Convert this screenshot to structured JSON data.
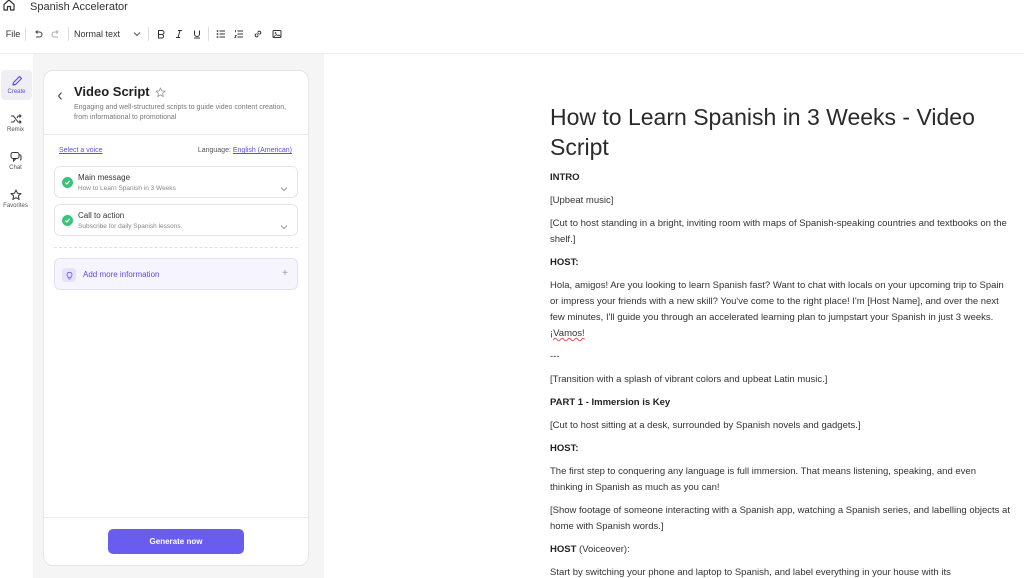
{
  "app": {
    "doc_title": "Spanish Accelerator"
  },
  "toolbar": {
    "file_label": "File",
    "text_style": "Normal text"
  },
  "rail": {
    "items": [
      {
        "label": "Create"
      },
      {
        "label": "Remix"
      },
      {
        "label": "Chat"
      },
      {
        "label": "Favorites"
      }
    ]
  },
  "panel": {
    "title": "Video Script",
    "description": "Engaging and well-structured scripts to guide video content creation, from informational to promotional",
    "voice_link": "Select a voice",
    "language_label": "Language:",
    "language_value": "English (American)",
    "fields": [
      {
        "title": "Main message",
        "value": "How to Learn Spanish in 3 Weeks"
      },
      {
        "title": "Call to action",
        "value": "Subscribe for daily Spanish lessons."
      }
    ],
    "add_info_label": "Add more information",
    "add_info_plus": "+",
    "generate_label": "Generate now"
  },
  "document": {
    "title": "How to Learn Spanish in 3 Weeks - Video Script",
    "intro": "INTRO",
    "p1": "[Upbeat music]",
    "p2": "[Cut to host standing in a bright, inviting room with maps of Spanish-speaking countries and textbooks on the shelf.]",
    "host1": "HOST:",
    "p3_main": "Hola, amigos! Are you looking to learn Spanish fast? Want to chat with locals on your upcoming trip to Spain or impress your friends with a new skill? You've come to the right place! I'm [Host Name], and over the next few minutes, I'll guide you through an accelerated learning plan to jumpstart your Spanish in just 3 weeks. ",
    "p3_spell": "¡Vamos!",
    "sep": "---",
    "p4": "[Transition with a splash of vibrant colors and upbeat Latin music.]",
    "part1": "PART 1 - Immersion is Key",
    "p5": "[Cut to host sitting at a desk, surrounded by Spanish novels and gadgets.]",
    "host2": "HOST:",
    "p6": "The first step to conquering any language is full immersion. That means listening, speaking, and even thinking in Spanish as much as you can!",
    "p7": "[Show footage of someone interacting with a Spanish app, watching a Spanish series, and labelling objects at home with Spanish words.]",
    "host3_bold": "HOST",
    "host3_rest": " (Voiceover):",
    "p8": "Start by switching your phone and laptop to Spanish, and label everything in your house with its"
  }
}
